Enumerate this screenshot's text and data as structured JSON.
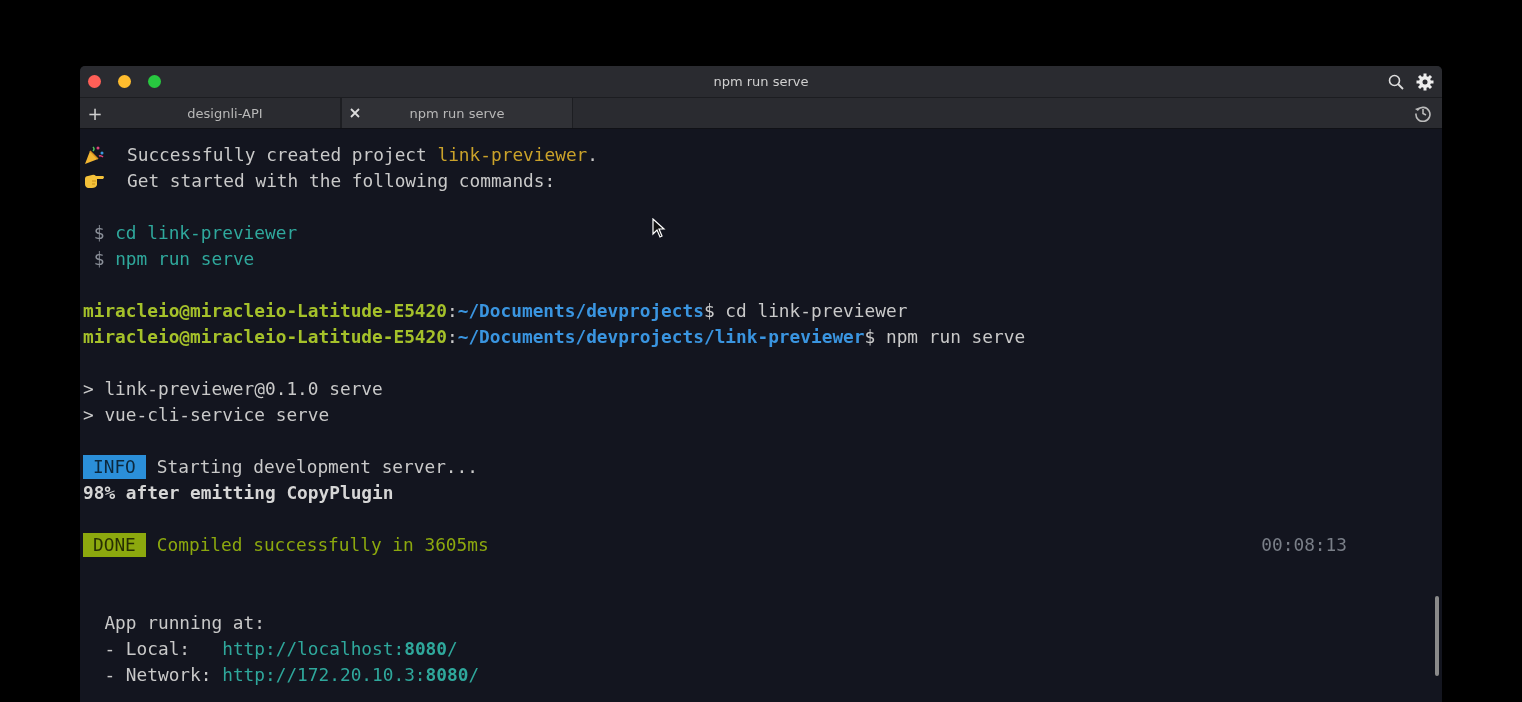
{
  "window": {
    "title": "npm run serve"
  },
  "new_tab_button": "+",
  "tabs": [
    {
      "label": "designli-API",
      "selected": false
    },
    {
      "label": "npm run serve",
      "selected": true
    }
  ],
  "lines": [
    {
      "kind": "celebration",
      "spans": [
        {
          "text": "Successfully created project ",
          "kind": "plain"
        },
        {
          "text": "link-previewer",
          "kind": "accent"
        },
        {
          "text": ".",
          "kind": "plain"
        }
      ]
    },
    {
      "kind": "pointer",
      "spans": [
        {
          "text": "Get started with the following commands:",
          "kind": "plain"
        }
      ]
    },
    {
      "kind": "blank"
    },
    {
      "kind": "text",
      "spans": [
        {
          "text": " $ ",
          "kind": "dim"
        },
        {
          "text": "cd link-previewer",
          "kind": "command"
        }
      ]
    },
    {
      "kind": "text",
      "spans": [
        {
          "text": " $ ",
          "kind": "dim"
        },
        {
          "text": "npm run serve",
          "kind": "command"
        }
      ]
    },
    {
      "kind": "blank"
    },
    {
      "kind": "text",
      "spans": [
        {
          "text": "miracleio@miracleio-Latitude-E5420",
          "kind": "user"
        },
        {
          "text": ":",
          "kind": "plain"
        },
        {
          "text": "~/Documents/devprojects",
          "kind": "path"
        },
        {
          "text": "$ cd link-previewer",
          "kind": "plain"
        }
      ]
    },
    {
      "kind": "text",
      "spans": [
        {
          "text": "miracleio@miracleio-Latitude-E5420",
          "kind": "user"
        },
        {
          "text": ":",
          "kind": "plain"
        },
        {
          "text": "~/Documents/devprojects/link-previewer",
          "kind": "path"
        },
        {
          "text": "$ npm run serve",
          "kind": "plain"
        }
      ]
    },
    {
      "kind": "blank"
    },
    {
      "kind": "text",
      "spans": [
        {
          "text": "> link-previewer@0.1.0 serve",
          "kind": "plain"
        }
      ]
    },
    {
      "kind": "text",
      "spans": [
        {
          "text": "> vue-cli-service serve",
          "kind": "plain"
        }
      ]
    },
    {
      "kind": "blank"
    },
    {
      "kind": "badge",
      "badge": {
        "text": "INFO",
        "color": "#2b8fd9"
      },
      "spans": [
        {
          "text": "Starting development server...",
          "kind": "plain"
        }
      ]
    },
    {
      "kind": "text",
      "spans": [
        {
          "text": "98% after emitting CopyPlugin",
          "kind": "bold"
        }
      ]
    },
    {
      "kind": "blank"
    },
    {
      "kind": "badge",
      "badge": {
        "text": "DONE",
        "color": "#8ca80e"
      },
      "spans": [
        {
          "text": "Compiled successfully in 3605ms",
          "kind": "success"
        }
      ],
      "aside": "00:08:13"
    },
    {
      "kind": "blank"
    },
    {
      "kind": "blank"
    },
    {
      "kind": "text",
      "spans": [
        {
          "text": "  App running at:",
          "kind": "plain"
        }
      ]
    },
    {
      "kind": "text",
      "spans": [
        {
          "text": "  - Local:   ",
          "kind": "plain"
        },
        {
          "text": "http://localhost:",
          "kind": "command"
        },
        {
          "text": "8080",
          "kind": "command-bold"
        },
        {
          "text": "/",
          "kind": "command"
        }
      ]
    },
    {
      "kind": "text",
      "spans": [
        {
          "text": "  - Network: ",
          "kind": "plain"
        },
        {
          "text": "http://172.20.10.3:",
          "kind": "command"
        },
        {
          "text": "8080",
          "kind": "command-bold"
        },
        {
          "text": "/",
          "kind": "command"
        }
      ]
    }
  ]
}
